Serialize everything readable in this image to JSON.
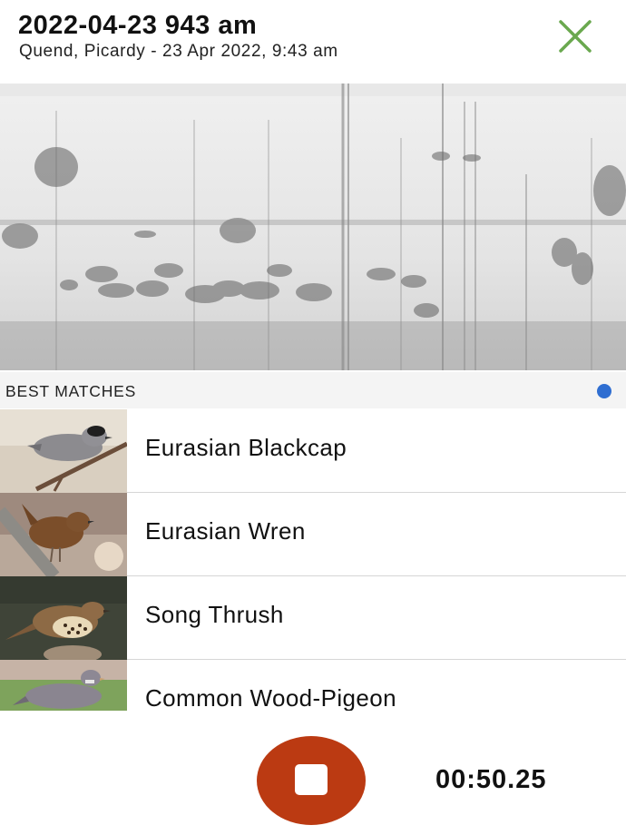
{
  "header": {
    "title": "2022-04-23 943 am",
    "subtitle": "Quend, Picardy - 23 Apr 2022, 9:43 am",
    "close_icon": "close-x-icon",
    "accent_color": "#6aa84f"
  },
  "spectrogram": {
    "icon": "spectrogram-image"
  },
  "matches": {
    "section_label": "BEST MATCHES",
    "status_dot_color": "#2f6ed1",
    "items": [
      {
        "name": "Eurasian Blackcap",
        "photo": "eurasian-blackcap-photo"
      },
      {
        "name": "Eurasian Wren",
        "photo": "eurasian-wren-photo"
      },
      {
        "name": "Song Thrush",
        "photo": "song-thrush-photo"
      },
      {
        "name": "Common Wood-Pigeon",
        "photo": "common-wood-pigeon-photo"
      }
    ]
  },
  "recorder": {
    "timer": "00:50.25",
    "stop_icon": "stop-icon",
    "button_color": "#bb3a12"
  }
}
